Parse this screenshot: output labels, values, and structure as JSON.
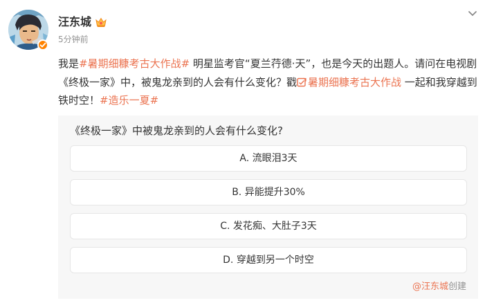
{
  "post": {
    "author": "汪东城",
    "time": "5分钟前",
    "text": {
      "p1": "我是",
      "topic1": "#暑期细糠考古大作战#",
      "p2": " 明星监考官“夏兰荇德·天”，也是今天的出题人。请问在电视剧《终极一家》中，被鬼龙亲到的人会有什么变化？戳",
      "topic2_link": "暑期细糠考古大作战",
      "p3": " 一起和我穿越到铁时空！",
      "topic3": "#造乐一夏#"
    }
  },
  "poll": {
    "question": "《终极一家》中被鬼龙亲到的人会有什么变化?",
    "options": [
      "A. 流眼泪3天",
      "B. 异能提升30%",
      "C. 发花痴、大肚子3天",
      "D. 穿越到另一个时空"
    ],
    "creator_name": "@汪东城",
    "creator_suffix": "创建"
  },
  "icons": {
    "more": "chevron-down-icon",
    "verified": "verified-badge-icon",
    "crown": "crown-icon",
    "poll_link": "vote-link-icon"
  },
  "colors": {
    "accent": "#eb7350",
    "verified": "#ff8200",
    "poll_bg": "#f7f7f7"
  }
}
